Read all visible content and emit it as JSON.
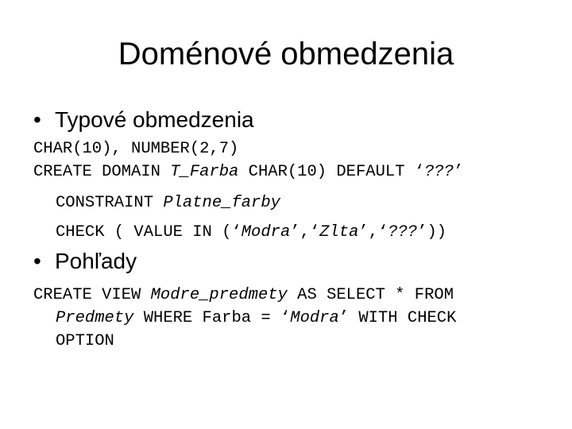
{
  "slide": {
    "title": "Doménové obmedzenia",
    "bullet_glyph": "•",
    "sections": [
      {
        "heading": "Typové obmedzenia",
        "lines": [
          [
            {
              "text": "CHAR(10), NUMBER(2,7)",
              "italic": false
            }
          ],
          [
            {
              "text": "CREATE DOMAIN ",
              "italic": false
            },
            {
              "text": "T_Farba",
              "italic": true
            },
            {
              "text": " CHAR(10) DEFAULT ‘",
              "italic": false
            },
            {
              "text": "???",
              "italic": true
            },
            {
              "text": "’",
              "italic": false
            }
          ],
          [
            {
              "text": "CONSTRAINT ",
              "italic": false
            },
            {
              "text": "Platne_farby",
              "italic": true
            }
          ],
          [
            {
              "text": "CHECK ( VALUE IN (‘",
              "italic": false
            },
            {
              "text": "Modra",
              "italic": true
            },
            {
              "text": "’,‘",
              "italic": false
            },
            {
              "text": "Zlta",
              "italic": true
            },
            {
              "text": "’,‘",
              "italic": false
            },
            {
              "text": "???",
              "italic": true
            },
            {
              "text": "’))",
              "italic": false
            }
          ]
        ]
      },
      {
        "heading": "Pohľady",
        "lines": [
          [
            {
              "text": "CREATE VIEW ",
              "italic": false
            },
            {
              "text": "Modre_predmety",
              "italic": true
            },
            {
              "text": " AS SELECT * FROM",
              "italic": false
            }
          ],
          [
            {
              "text": "Predmety",
              "italic": true
            },
            {
              "text": " WHERE Farba = ‘",
              "italic": false
            },
            {
              "text": "Modra",
              "italic": true
            },
            {
              "text": "’ WITH CHECK",
              "italic": false
            }
          ],
          [
            {
              "text": "OPTION",
              "italic": false
            }
          ]
        ]
      }
    ]
  }
}
